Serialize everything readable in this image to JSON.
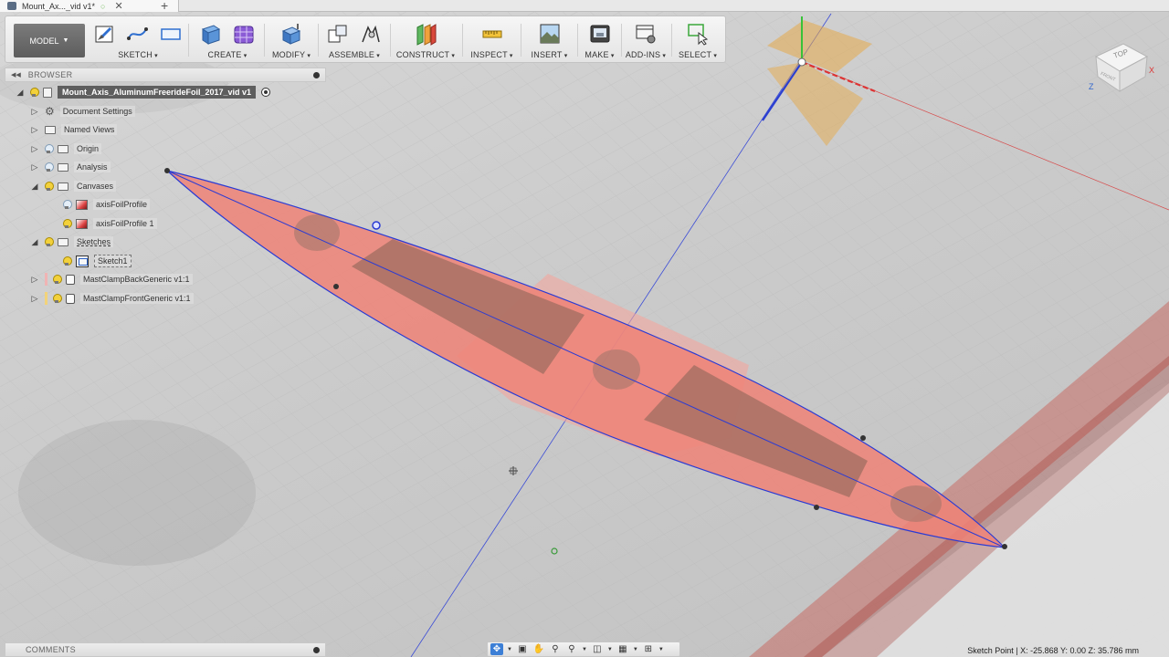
{
  "document_tab": {
    "title": "Mount_Ax..._vid v1*",
    "status_dot": "○",
    "close": "✕",
    "new_tab": "+"
  },
  "toolbar": {
    "workspace": "MODEL",
    "groups": [
      {
        "label": "SKETCH"
      },
      {
        "label": "CREATE"
      },
      {
        "label": "MODIFY"
      },
      {
        "label": "ASSEMBLE"
      },
      {
        "label": "CONSTRUCT"
      },
      {
        "label": "INSPECT"
      },
      {
        "label": "INSERT"
      },
      {
        "label": "MAKE"
      },
      {
        "label": "ADD-INS"
      },
      {
        "label": "SELECT"
      }
    ]
  },
  "browser": {
    "title": "BROWSER",
    "root": "Mount_Axis_AluminumFreerideFoil_2017_vid v1",
    "items": [
      {
        "label": "Document Settings"
      },
      {
        "label": "Named Views"
      },
      {
        "label": "Origin"
      },
      {
        "label": "Analysis"
      },
      {
        "label": "Canvases"
      },
      {
        "label": "axisFoilProfile"
      },
      {
        "label": "axisFoilProfile 1"
      },
      {
        "label": "Sketches"
      },
      {
        "label": "Sketch1"
      },
      {
        "label": "MastClampBackGeneric v1:1"
      },
      {
        "label": "MastClampFrontGeneric v1:1"
      }
    ]
  },
  "comments": {
    "title": "COMMENTS"
  },
  "status_bar": {
    "text": "Sketch Point | X: -25.868 Y: 0.00 Z: 35.786 mm"
  },
  "view_cube": {
    "top": "TOP",
    "front": "FRONT",
    "axis_x": "X",
    "axis_z": "Z"
  },
  "colors": {
    "sketch_line": "#2a3bd4",
    "canvas_fill": "#f08a80",
    "toolbar_bg": "#ececec",
    "workspace_btn": "#6a6a6a"
  }
}
